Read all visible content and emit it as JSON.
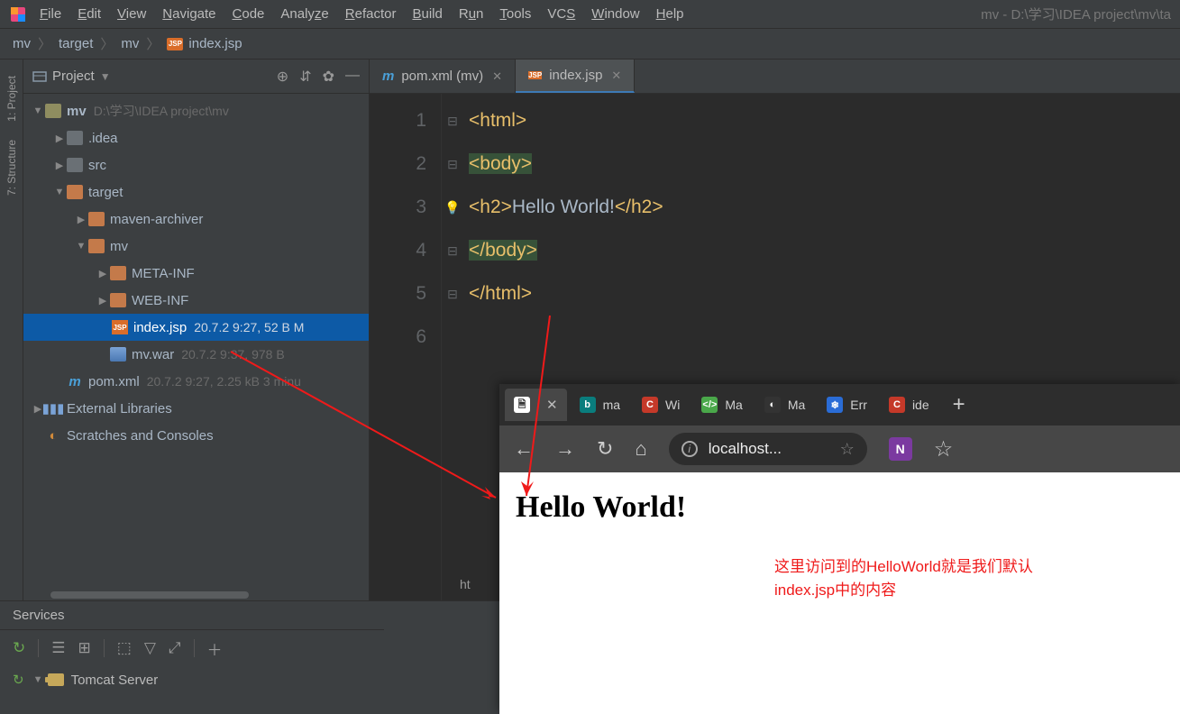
{
  "menubar": {
    "items": [
      "File",
      "Edit",
      "View",
      "Navigate",
      "Code",
      "Analyze",
      "Refactor",
      "Build",
      "Run",
      "Tools",
      "VCS",
      "Window",
      "Help"
    ],
    "title": "mv - D:\\学习\\IDEA project\\mv\\ta"
  },
  "breadcrumbs": {
    "root": "mv",
    "p1": "target",
    "p2": "mv",
    "file": "index.jsp"
  },
  "sidebar": {
    "tab1": "1: Project",
    "tab2": "7: Structure"
  },
  "project_panel": {
    "title": "Project",
    "tree": {
      "root": "mv",
      "root_path": "D:\\学习\\IDEA project\\mv",
      "idea": ".idea",
      "src": "src",
      "target": "target",
      "maven_archiver": "maven-archiver",
      "mv": "mv",
      "meta_inf": "META-INF",
      "web_inf": "WEB-INF",
      "index_jsp": "index.jsp",
      "index_jsp_meta": "20.7.2 9:27, 52 B M",
      "mv_war": "mv.war",
      "mv_war_meta": "20.7.2 9:37, 978 B",
      "pom_xml": "pom.xml",
      "pom_xml_meta": "20.7.2 9:27, 2.25 kB 3 minu",
      "ext_lib": "External Libraries",
      "scratches": "Scratches and Consoles"
    }
  },
  "editor": {
    "tabs": {
      "pom": "pom.xml (mv)",
      "index": "index.jsp"
    },
    "code": {
      "l1": "<html>",
      "l2": "<body>",
      "l3a": "<h2>",
      "l3b": "Hello World!",
      "l3c": "</h2>",
      "l4": "</body>",
      "l5": "</html>"
    },
    "status": "ht"
  },
  "services": {
    "title": "Services",
    "server": "Tomcat Server"
  },
  "browser": {
    "tabs": {
      "ma1": "ma",
      "wi": "Wi",
      "ma2": "Ma",
      "ma3": "Ma",
      "err": "Err",
      "ide": "ide"
    },
    "url": "localhost...",
    "page_h2": "Hello World!"
  },
  "annotation": {
    "line1": "这里访问到的HelloWorld就是我们默认",
    "line2": "index.jsp中的内容"
  }
}
